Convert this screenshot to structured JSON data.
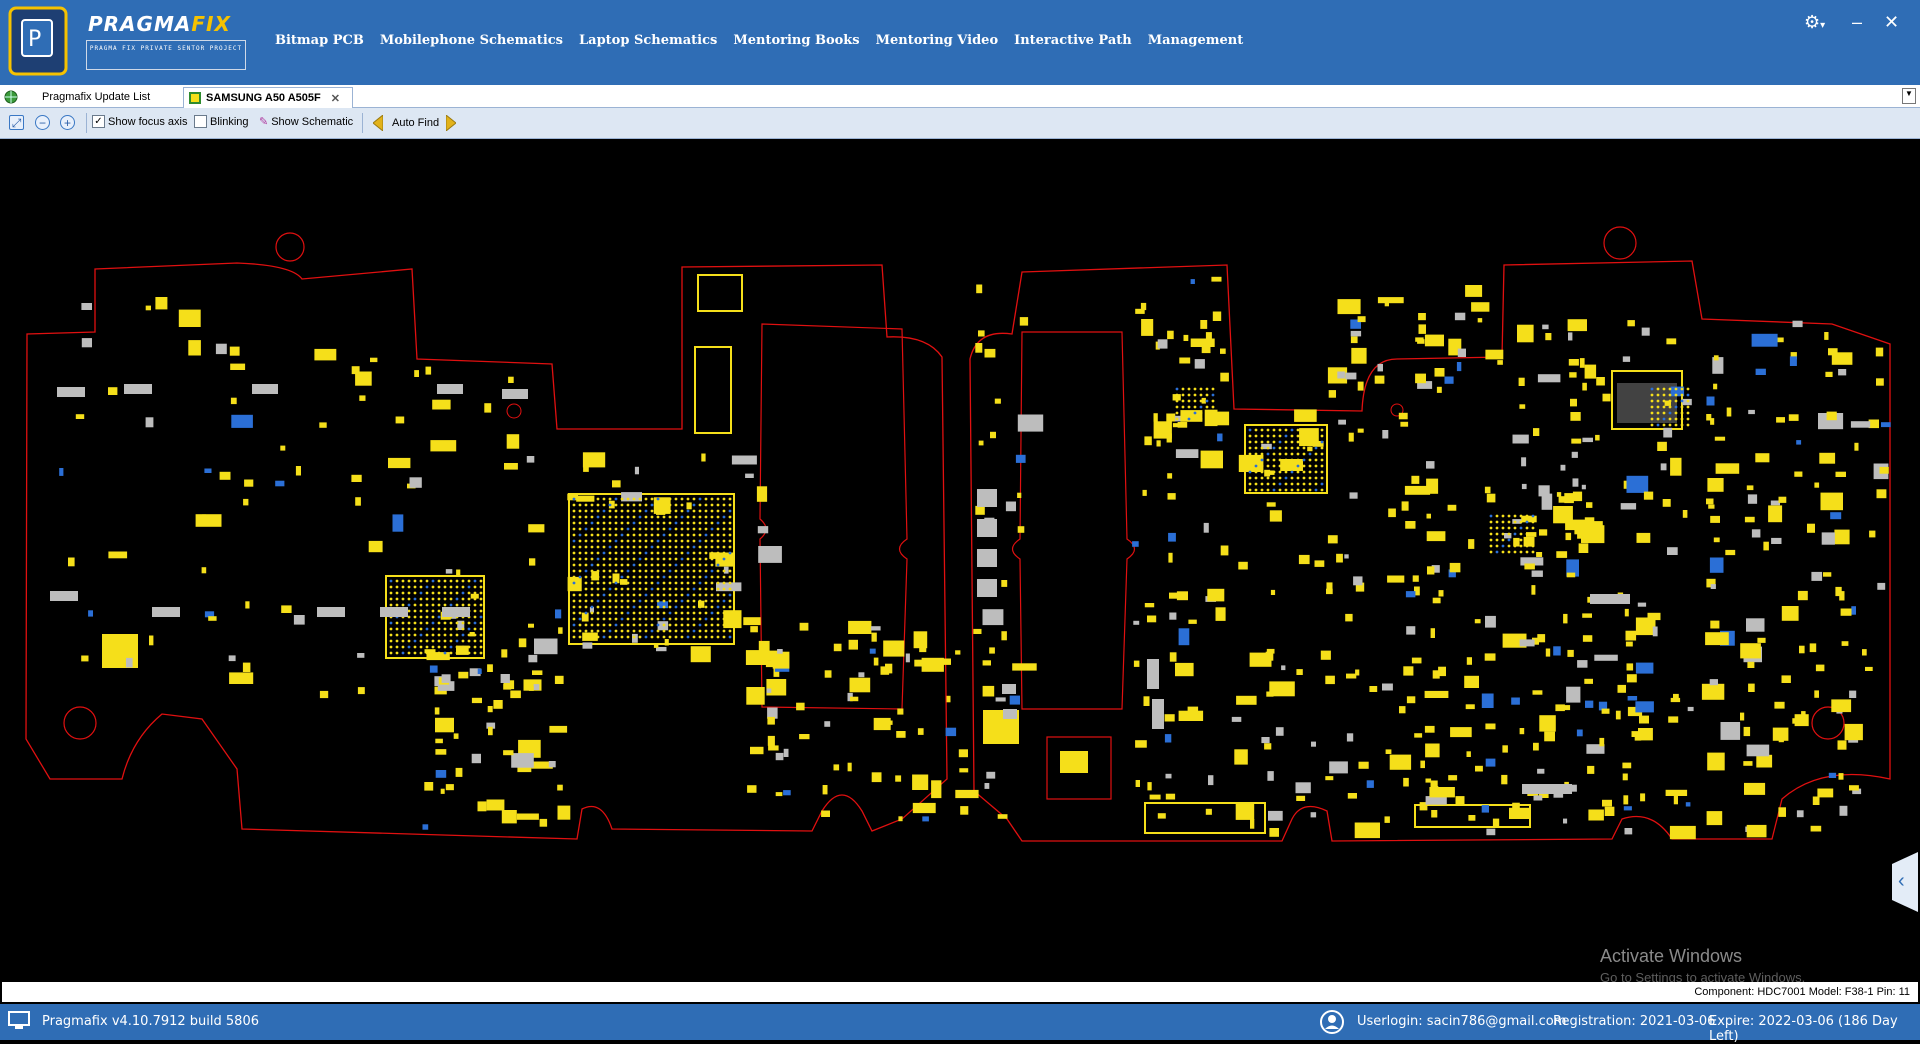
{
  "app": {
    "logo_main": "PRAGMA",
    "logo_accent": "FIX",
    "logo_sub": "PRAGMA FIX PRIVATE SENTOR PROJECT"
  },
  "nav": [
    "Bitmap PCB",
    "Mobilephone Schematics",
    "Laptop Schematics",
    "Mentoring Books",
    "Mentoring Video",
    "Interactive Path",
    "Management"
  ],
  "tabs": [
    {
      "label": "Pragmafix Update List"
    },
    {
      "label": "SAMSUNG A50 A505F"
    }
  ],
  "toolbar": {
    "show_focus_axis": "Show focus axis",
    "blinking": "Blinking",
    "show_schematic": "Show Schematic",
    "auto_find": "Auto Find"
  },
  "watermark": {
    "line1": "Activate Windows",
    "line2": "Go to Settings to activate Windows."
  },
  "component_info": "Component: HDC7001 Model: F38-1 Pin: 11",
  "status": {
    "version": "Pragmafix v4.10.7912 build 5806",
    "user": "Userlogin: sacin786@gmail.com",
    "registration": "Registration: 2021-03-06",
    "expire": "Expire: 2022-03-06 (186 Day Left)"
  },
  "colors": {
    "accent": "#2f6db5",
    "outline": "#e01010",
    "pad_yellow": "#f5df1a",
    "pad_gray": "#bdbdbd",
    "pad_blue": "#2b6fd6"
  }
}
